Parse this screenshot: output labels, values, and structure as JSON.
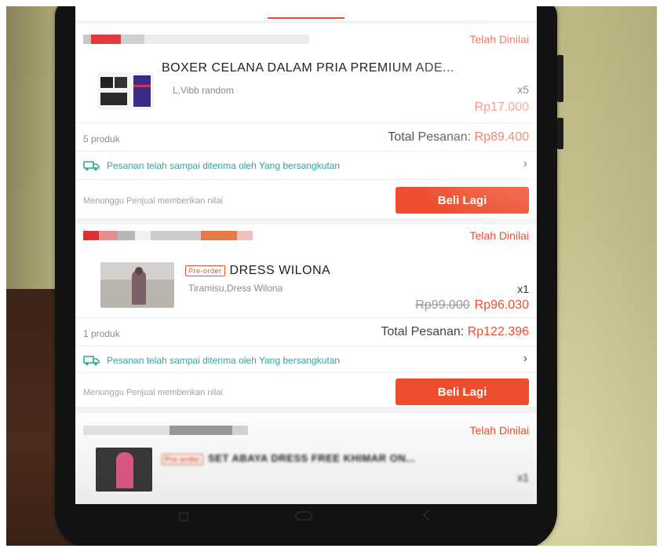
{
  "orders": [
    {
      "status": "Telah Dinilai",
      "product_name": "BOXER CELANA DALAM PRIA PREMIUM ADE...",
      "variation": "L,Vibb random",
      "quantity": "x5",
      "price": "Rp17.000",
      "item_count": "5 produk",
      "total_label": "Total Pesanan:",
      "total_amount": "Rp89.400",
      "delivery_text": "Pesanan telah sampai diterima oleh Yang bersangkutan",
      "waiting_text": "Menunggu Penjual memberikan nilai",
      "buy_again_label": "Beli Lagi"
    },
    {
      "status": "Telah Dinilai",
      "preorder_badge": "Pre-order",
      "product_name": "DRESS WILONA",
      "variation": "Tiramisu,Dress Wilona",
      "quantity": "x1",
      "original_price": "Rp99.000",
      "price": "Rp96.030",
      "item_count": "1 produk",
      "total_label": "Total Pesanan:",
      "total_amount": "Rp122.396",
      "delivery_text": "Pesanan telah sampai diterima oleh Yang bersangkutan",
      "waiting_text": "Menunggu Penjual memberikan nilai",
      "buy_again_label": "Beli Lagi"
    },
    {
      "status": "Telah Dinilai",
      "preorder_badge": "Pre-order",
      "product_name": "SET ABAYA DRESS FREE KHIMAR ON...",
      "quantity": "x1"
    }
  ],
  "icons": {
    "chevron": "›",
    "truck": "truck-icon"
  },
  "colors": {
    "accent": "#ee4d2d",
    "delivery_green": "#26aa99"
  }
}
